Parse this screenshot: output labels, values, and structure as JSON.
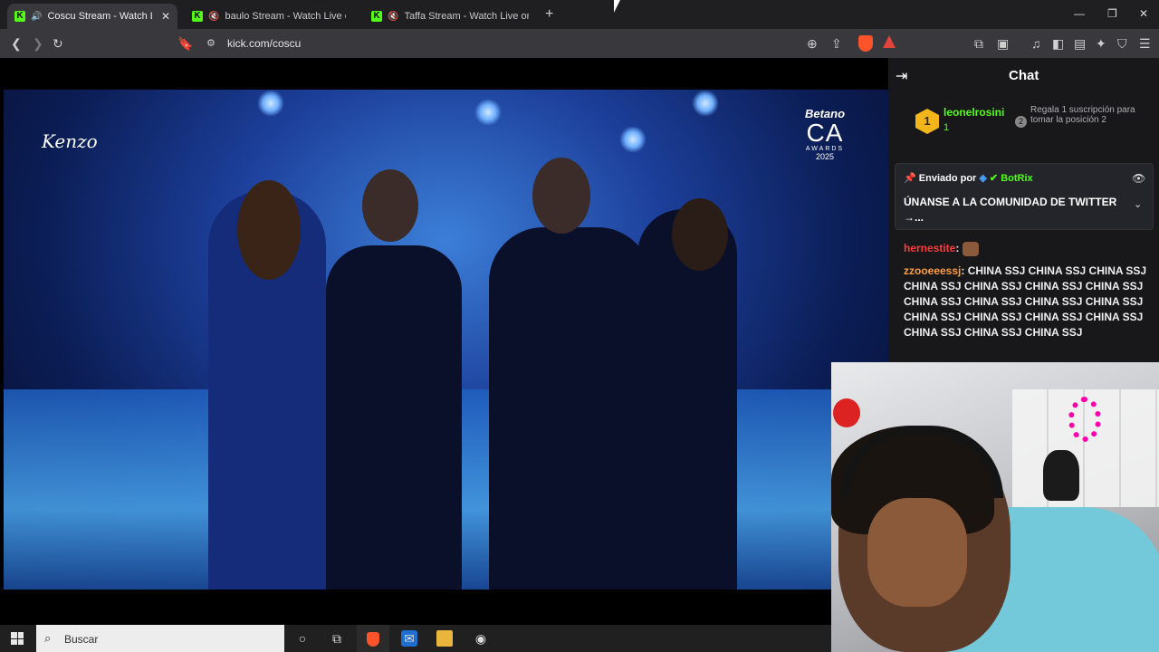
{
  "tabs": [
    {
      "title": "Coscu Stream - Watch Live on",
      "active": true,
      "audio": true
    },
    {
      "title": "baulo Stream - Watch Live on Kick",
      "active": false,
      "audio": false
    },
    {
      "title": "Taffa Stream - Watch Live on Kick",
      "active": false,
      "audio": false
    }
  ],
  "tab_close": "✕",
  "newtab": "+",
  "window": {
    "minimize": "—",
    "restore": "❐",
    "close": "✕"
  },
  "address": {
    "url": "kick.com/coscu",
    "badge_count": "1"
  },
  "video": {
    "signature": "Kenzo",
    "award": {
      "brand": "Betano",
      "name": "CA",
      "sub": "AWARDS",
      "year": "2025"
    }
  },
  "chat": {
    "title": "Chat",
    "leaderboard": {
      "rank1": "1",
      "user": "leonelrosini",
      "count": "1",
      "rank2": "2",
      "note": "Regala 1 suscripción para tomar la posición 2"
    },
    "pinned": {
      "sent_by_label": "Enviado por",
      "sender": "BotRix",
      "text": "ÚNANSE A LA COMUNIDAD DE TWITTER →..."
    },
    "messages": [
      {
        "user": "hernestite",
        "text": ""
      },
      {
        "user": "zzooeeessj",
        "text": "CHINA SSJ CHINA SSJ CHINA SSJ CHINA SSJ CHINA SSJ CHINA SSJ CHINA SSJ CHINA SSJ CHINA SSJ CHINA SSJ CHINA SSJ CHINA SSJ CHINA SSJ CHINA SSJ CHINA SSJ CHINA SSJ CHINA SSJ CHINA SSJ"
      }
    ]
  },
  "taskbar": {
    "search_placeholder": "Buscar"
  },
  "colors": {
    "kick_green": "#53fc18",
    "brave_orange": "#fb542b",
    "chat_bg": "#18181b"
  }
}
